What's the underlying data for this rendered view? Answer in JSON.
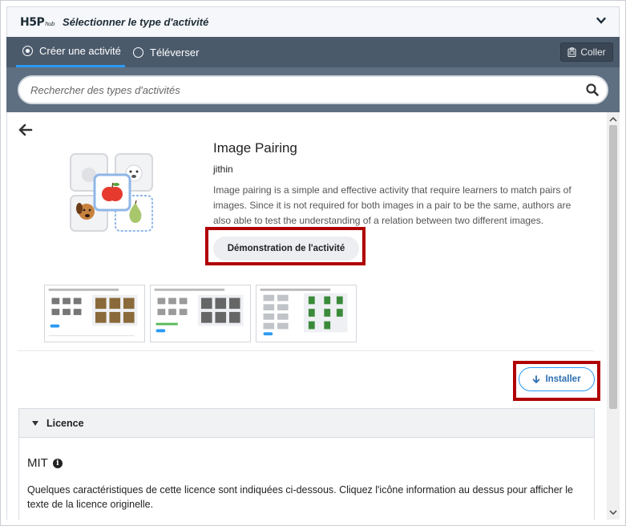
{
  "header": {
    "logo_text": "H5P",
    "logo_sub": "hub",
    "title": "Sélectionner le type d'activité"
  },
  "tabs": {
    "create_label": "Créer une activité",
    "upload_label": "Téléverser",
    "paste_label": "Coller"
  },
  "search": {
    "placeholder": "Rechercher des types d'activités"
  },
  "activity": {
    "title": "Image Pairing",
    "author": "jithin",
    "description": "Image pairing is a simple and effective activity that require learners to match pairs of images. Since it is not required for both images in a pair to be the same, authors are also able to test the understanding of a relation between two different images.",
    "demo_label": "Démonstration de l'activité",
    "install_label": "Installer"
  },
  "licence": {
    "heading": "Licence",
    "name": "MIT",
    "text": "Quelques caractéristiques de cette licence sont indiquées ci-dessous. Cliquez l'icône information au dessus pour afficher le texte de la licence originelle."
  },
  "colors": {
    "tabs_bg": "#4b5a6b",
    "search_bg": "#5e6f81",
    "accent": "#2b9af3",
    "highlight": "#b00000"
  }
}
